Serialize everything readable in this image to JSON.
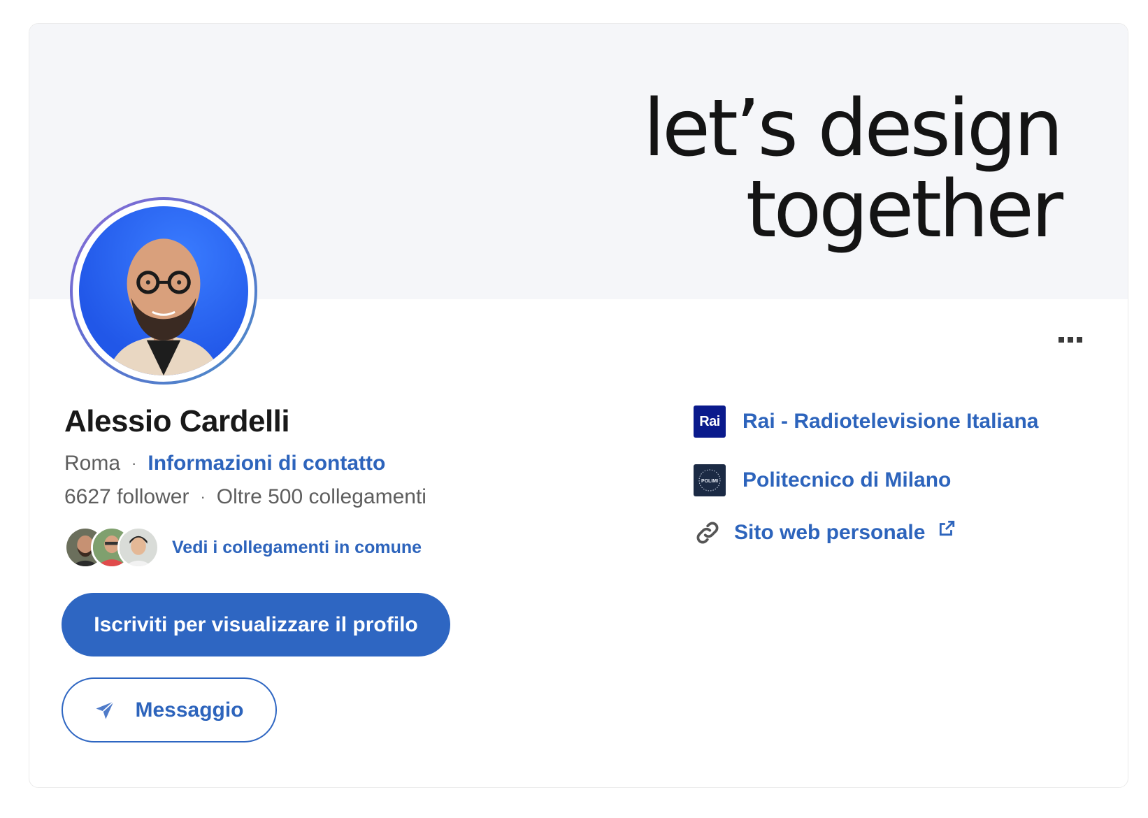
{
  "cover": {
    "line1": "let’s design",
    "line2": "together"
  },
  "profile": {
    "name": "Alessio Cardelli",
    "location": "Roma",
    "contact_link": "Informazioni di contatto",
    "followers": "6627 follower",
    "connections": "Oltre 500 collegamenti",
    "separator": "·",
    "mutual_link": "Vedi i collegamenti in comune"
  },
  "actions": {
    "primary_label": "Iscriviti per visualizzare il profilo",
    "message_label": "Messaggio"
  },
  "side_links": {
    "company_logo_text": "Rai",
    "company": "Rai - Radiotelevisione Italiana",
    "school_logo_text": "POLIMI",
    "school": "Politecnico di Milano",
    "website": "Sito web personale"
  },
  "icons": {
    "more": "more-horizontal-icon",
    "message": "send-icon",
    "website": "link-icon",
    "external": "external-link-icon"
  },
  "colors": {
    "accent": "#2e66c2",
    "link": "#2d64bc",
    "cover_bg": "#f5f6f9",
    "avatar_bg": "#2157e8",
    "rai_blue": "#0a1a8c"
  }
}
